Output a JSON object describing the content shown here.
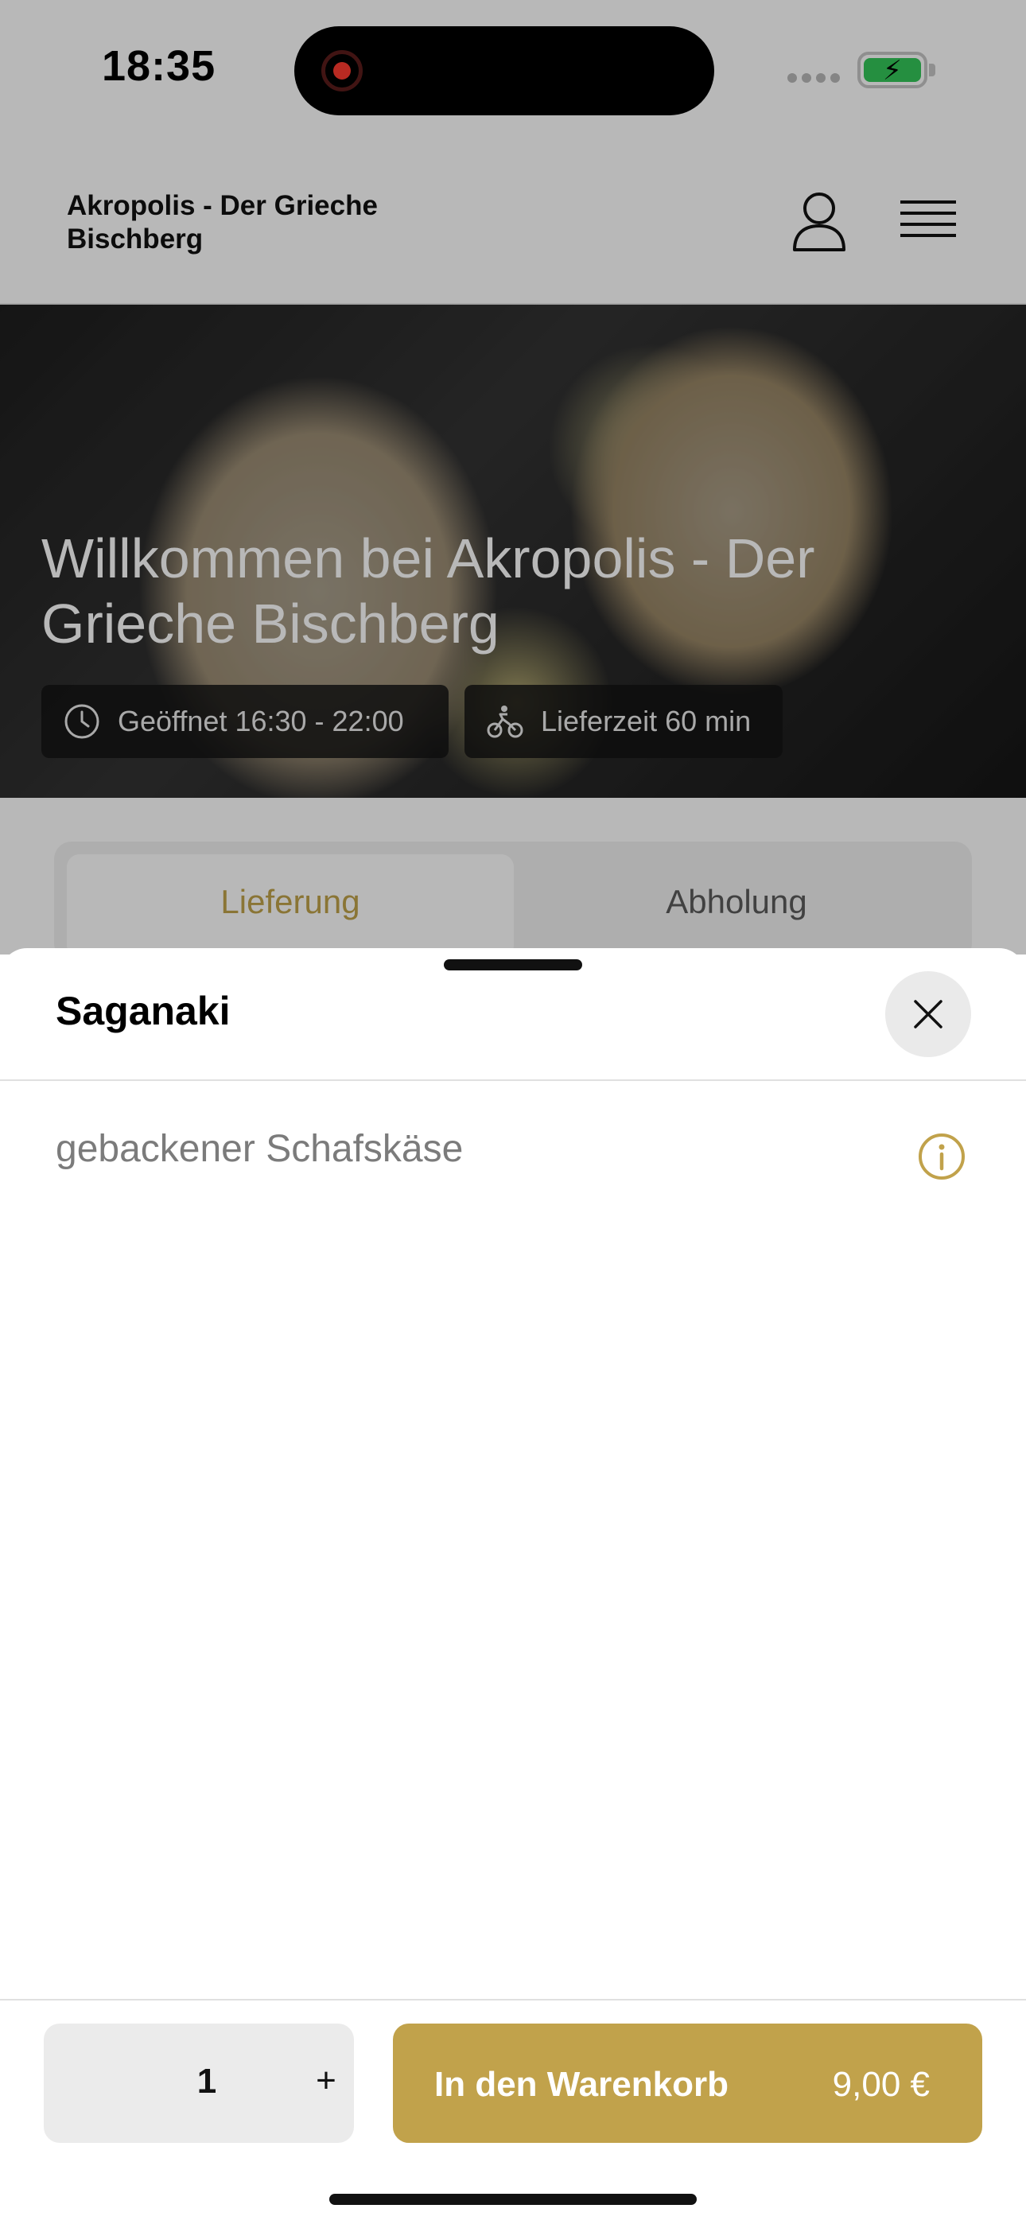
{
  "status_bar": {
    "time": "18:35"
  },
  "header": {
    "restaurant_name": "Akropolis - Der Grieche Bischberg",
    "icons": [
      "person-icon",
      "hamburger-menu-icon"
    ]
  },
  "hero": {
    "title": "Willkommen bei Akropolis - Der Grieche Bischberg",
    "opening_hours": "Geöffnet 16:30 - 22:00",
    "delivery_time": "Lieferzeit 60 min"
  },
  "mode_tabs": {
    "delivery": "Lieferung",
    "pickup": "Abholung",
    "active": "Lieferung"
  },
  "sheet": {
    "title": "Saganaki",
    "description": "gebackener Schafskäse",
    "quantity": "1",
    "plus": "+",
    "cart_button_label": "In den Warenkorb",
    "price": "9,00 €"
  },
  "colors": {
    "accent": "#C1A24B",
    "battery": "#34C759",
    "record": "#FF3B30"
  }
}
